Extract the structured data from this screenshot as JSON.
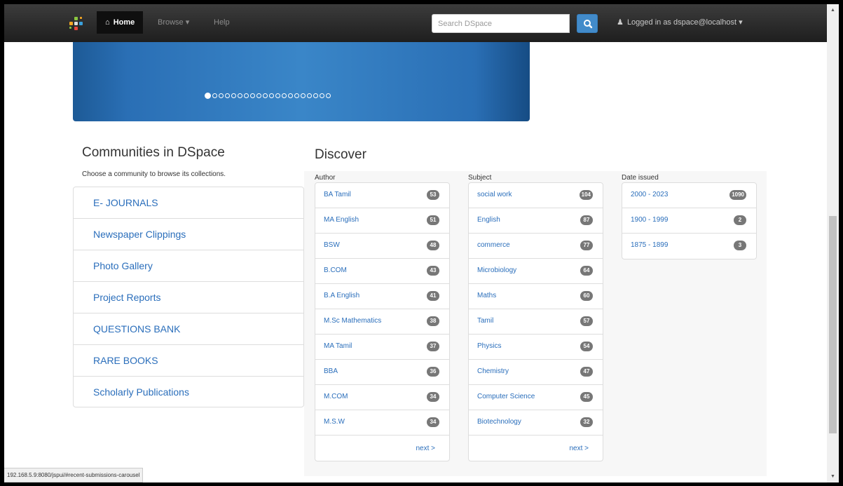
{
  "navbar": {
    "home_label": "Home",
    "browse_label": "Browse",
    "help_label": "Help",
    "search_placeholder": "Search DSpace",
    "user_label": "Logged in as dspace@localhost"
  },
  "carousel": {
    "slide_count": 20,
    "active_index": 0
  },
  "communities": {
    "title": "Communities in DSpace",
    "subtitle": "Choose a community to browse its collections.",
    "items": [
      {
        "label": "E- JOURNALS"
      },
      {
        "label": "Newspaper Clippings"
      },
      {
        "label": "Photo Gallery"
      },
      {
        "label": "Project Reports"
      },
      {
        "label": "QUESTIONS BANK"
      },
      {
        "label": "RARE BOOKS"
      },
      {
        "label": "Scholarly Publications"
      }
    ]
  },
  "discover": {
    "title": "Discover",
    "author": {
      "label": "Author",
      "items": [
        {
          "label": "BA Tamil",
          "count": "53"
        },
        {
          "label": "MA English",
          "count": "51"
        },
        {
          "label": "BSW",
          "count": "48"
        },
        {
          "label": "B.COM",
          "count": "43"
        },
        {
          "label": "B.A English",
          "count": "41"
        },
        {
          "label": "M.Sc Mathematics",
          "count": "38"
        },
        {
          "label": "MA Tamil",
          "count": "37"
        },
        {
          "label": "BBA",
          "count": "36"
        },
        {
          "label": "M.COM",
          "count": "34"
        },
        {
          "label": "M.S.W",
          "count": "34"
        }
      ],
      "next_label": "next >"
    },
    "subject": {
      "label": "Subject",
      "items": [
        {
          "label": "social work",
          "count": "104"
        },
        {
          "label": "English",
          "count": "87"
        },
        {
          "label": "commerce",
          "count": "77"
        },
        {
          "label": "Microbiology",
          "count": "64"
        },
        {
          "label": "Maths",
          "count": "60"
        },
        {
          "label": "Tamil",
          "count": "57"
        },
        {
          "label": "Physics",
          "count": "54"
        },
        {
          "label": "Chemistry",
          "count": "47"
        },
        {
          "label": "Computer Science",
          "count": "45"
        },
        {
          "label": "Biotechnology",
          "count": "32"
        }
      ],
      "next_label": "next >"
    },
    "date_issued": {
      "label": "Date issued",
      "items": [
        {
          "label": "2000 - 2023",
          "count": "1090"
        },
        {
          "label": "1900 - 1999",
          "count": "2"
        },
        {
          "label": "1875 - 1899",
          "count": "3"
        }
      ]
    }
  },
  "status_bar": {
    "url": "192.168.5.9:8080/jspui/#recent-submissions-carousel"
  },
  "colors": {
    "link": "#2a6ebb",
    "navbar": "#222222",
    "carousel": "#3a86c8",
    "badge": "#777777",
    "search_button": "#428bca"
  }
}
